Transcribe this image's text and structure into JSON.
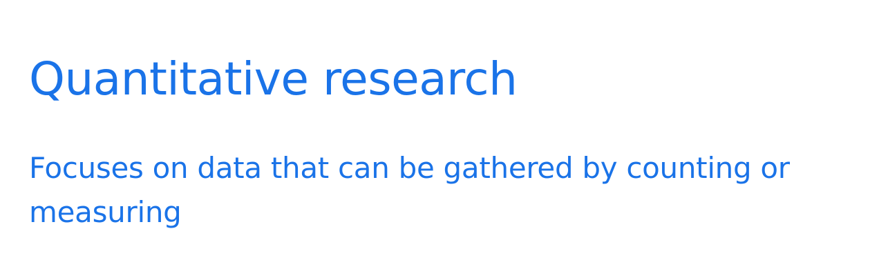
{
  "slide": {
    "title": "Quantitative research",
    "body": "Focuses on data that can be gathered by counting or measuring"
  },
  "colors": {
    "text_accent": "#1a73e8",
    "background": "#ffffff"
  }
}
